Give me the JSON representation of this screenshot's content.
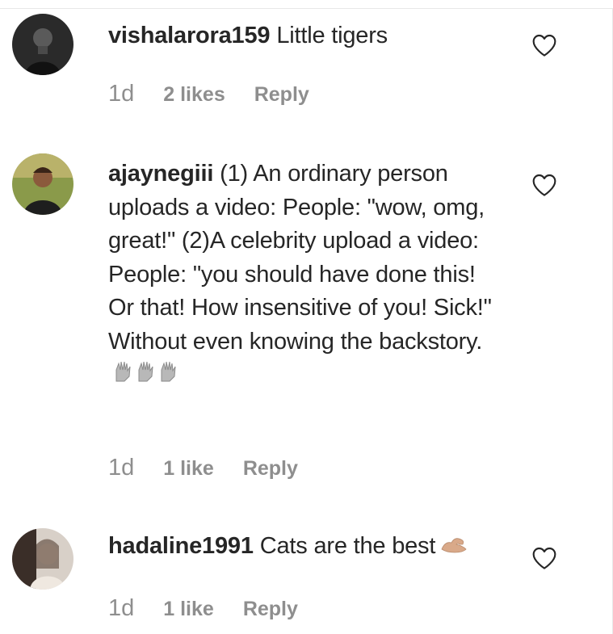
{
  "comments": [
    {
      "username": "vishalarora159",
      "text": "Little tigers",
      "time": "1d",
      "likes": "2 likes",
      "reply_label": "Reply",
      "avatar_icon": "user-avatar-dark"
    },
    {
      "username": "ajaynegiii",
      "text": "(1) An ordinary person uploads a video: People: \"wow, omg, great!\" (2)A celebrity upload a video: People: \"you should have done this! Or that! How insensitive of you! Sick!\" Without even knowing the backstory.",
      "emoji_icon": "clapping-hands-icon",
      "time": "1d",
      "likes": "1 like",
      "reply_label": "Reply",
      "avatar_icon": "user-avatar-outdoor"
    },
    {
      "username": "hadaline1991",
      "text": "Cats are the best",
      "emoji_icon": "flexed-biceps-icon",
      "time": "1d",
      "likes": "1 like",
      "reply_label": "Reply",
      "avatar_icon": "user-avatar-light"
    }
  ],
  "colors": {
    "text": "#262626",
    "meta": "#8e8e8e",
    "border": "#e8e8e8"
  }
}
